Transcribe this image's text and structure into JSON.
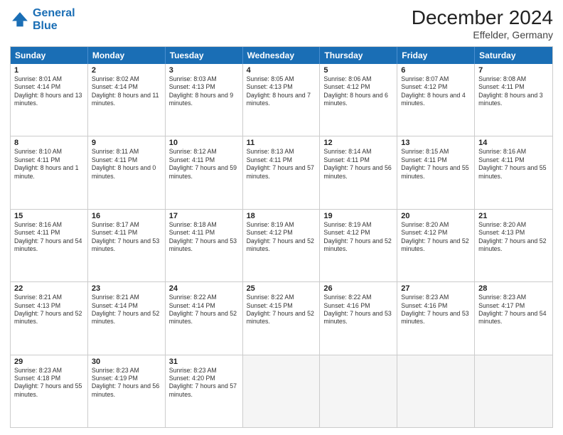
{
  "header": {
    "logo_line1": "General",
    "logo_line2": "Blue",
    "month_title": "December 2024",
    "location": "Effelder, Germany"
  },
  "days_of_week": [
    "Sunday",
    "Monday",
    "Tuesday",
    "Wednesday",
    "Thursday",
    "Friday",
    "Saturday"
  ],
  "weeks": [
    [
      {
        "day": "1",
        "lines": [
          "Sunrise: 8:01 AM",
          "Sunset: 4:14 PM",
          "Daylight: 8 hours",
          "and 13 minutes."
        ]
      },
      {
        "day": "2",
        "lines": [
          "Sunrise: 8:02 AM",
          "Sunset: 4:14 PM",
          "Daylight: 8 hours",
          "and 11 minutes."
        ]
      },
      {
        "day": "3",
        "lines": [
          "Sunrise: 8:03 AM",
          "Sunset: 4:13 PM",
          "Daylight: 8 hours",
          "and 9 minutes."
        ]
      },
      {
        "day": "4",
        "lines": [
          "Sunrise: 8:05 AM",
          "Sunset: 4:13 PM",
          "Daylight: 8 hours",
          "and 7 minutes."
        ]
      },
      {
        "day": "5",
        "lines": [
          "Sunrise: 8:06 AM",
          "Sunset: 4:12 PM",
          "Daylight: 8 hours",
          "and 6 minutes."
        ]
      },
      {
        "day": "6",
        "lines": [
          "Sunrise: 8:07 AM",
          "Sunset: 4:12 PM",
          "Daylight: 8 hours",
          "and 4 minutes."
        ]
      },
      {
        "day": "7",
        "lines": [
          "Sunrise: 8:08 AM",
          "Sunset: 4:11 PM",
          "Daylight: 8 hours",
          "and 3 minutes."
        ]
      }
    ],
    [
      {
        "day": "8",
        "lines": [
          "Sunrise: 8:10 AM",
          "Sunset: 4:11 PM",
          "Daylight: 8 hours",
          "and 1 minute."
        ]
      },
      {
        "day": "9",
        "lines": [
          "Sunrise: 8:11 AM",
          "Sunset: 4:11 PM",
          "Daylight: 8 hours",
          "and 0 minutes."
        ]
      },
      {
        "day": "10",
        "lines": [
          "Sunrise: 8:12 AM",
          "Sunset: 4:11 PM",
          "Daylight: 7 hours",
          "and 59 minutes."
        ]
      },
      {
        "day": "11",
        "lines": [
          "Sunrise: 8:13 AM",
          "Sunset: 4:11 PM",
          "Daylight: 7 hours",
          "and 57 minutes."
        ]
      },
      {
        "day": "12",
        "lines": [
          "Sunrise: 8:14 AM",
          "Sunset: 4:11 PM",
          "Daylight: 7 hours",
          "and 56 minutes."
        ]
      },
      {
        "day": "13",
        "lines": [
          "Sunrise: 8:15 AM",
          "Sunset: 4:11 PM",
          "Daylight: 7 hours",
          "and 55 minutes."
        ]
      },
      {
        "day": "14",
        "lines": [
          "Sunrise: 8:16 AM",
          "Sunset: 4:11 PM",
          "Daylight: 7 hours",
          "and 55 minutes."
        ]
      }
    ],
    [
      {
        "day": "15",
        "lines": [
          "Sunrise: 8:16 AM",
          "Sunset: 4:11 PM",
          "Daylight: 7 hours",
          "and 54 minutes."
        ]
      },
      {
        "day": "16",
        "lines": [
          "Sunrise: 8:17 AM",
          "Sunset: 4:11 PM",
          "Daylight: 7 hours",
          "and 53 minutes."
        ]
      },
      {
        "day": "17",
        "lines": [
          "Sunrise: 8:18 AM",
          "Sunset: 4:11 PM",
          "Daylight: 7 hours",
          "and 53 minutes."
        ]
      },
      {
        "day": "18",
        "lines": [
          "Sunrise: 8:19 AM",
          "Sunset: 4:12 PM",
          "Daylight: 7 hours",
          "and 52 minutes."
        ]
      },
      {
        "day": "19",
        "lines": [
          "Sunrise: 8:19 AM",
          "Sunset: 4:12 PM",
          "Daylight: 7 hours",
          "and 52 minutes."
        ]
      },
      {
        "day": "20",
        "lines": [
          "Sunrise: 8:20 AM",
          "Sunset: 4:12 PM",
          "Daylight: 7 hours",
          "and 52 minutes."
        ]
      },
      {
        "day": "21",
        "lines": [
          "Sunrise: 8:20 AM",
          "Sunset: 4:13 PM",
          "Daylight: 7 hours",
          "and 52 minutes."
        ]
      }
    ],
    [
      {
        "day": "22",
        "lines": [
          "Sunrise: 8:21 AM",
          "Sunset: 4:13 PM",
          "Daylight: 7 hours",
          "and 52 minutes."
        ]
      },
      {
        "day": "23",
        "lines": [
          "Sunrise: 8:21 AM",
          "Sunset: 4:14 PM",
          "Daylight: 7 hours",
          "and 52 minutes."
        ]
      },
      {
        "day": "24",
        "lines": [
          "Sunrise: 8:22 AM",
          "Sunset: 4:14 PM",
          "Daylight: 7 hours",
          "and 52 minutes."
        ]
      },
      {
        "day": "25",
        "lines": [
          "Sunrise: 8:22 AM",
          "Sunset: 4:15 PM",
          "Daylight: 7 hours",
          "and 52 minutes."
        ]
      },
      {
        "day": "26",
        "lines": [
          "Sunrise: 8:22 AM",
          "Sunset: 4:16 PM",
          "Daylight: 7 hours",
          "and 53 minutes."
        ]
      },
      {
        "day": "27",
        "lines": [
          "Sunrise: 8:23 AM",
          "Sunset: 4:16 PM",
          "Daylight: 7 hours",
          "and 53 minutes."
        ]
      },
      {
        "day": "28",
        "lines": [
          "Sunrise: 8:23 AM",
          "Sunset: 4:17 PM",
          "Daylight: 7 hours",
          "and 54 minutes."
        ]
      }
    ],
    [
      {
        "day": "29",
        "lines": [
          "Sunrise: 8:23 AM",
          "Sunset: 4:18 PM",
          "Daylight: 7 hours",
          "and 55 minutes."
        ]
      },
      {
        "day": "30",
        "lines": [
          "Sunrise: 8:23 AM",
          "Sunset: 4:19 PM",
          "Daylight: 7 hours",
          "and 56 minutes."
        ]
      },
      {
        "day": "31",
        "lines": [
          "Sunrise: 8:23 AM",
          "Sunset: 4:20 PM",
          "Daylight: 7 hours",
          "and 57 minutes."
        ]
      },
      {
        "day": "",
        "lines": []
      },
      {
        "day": "",
        "lines": []
      },
      {
        "day": "",
        "lines": []
      },
      {
        "day": "",
        "lines": []
      }
    ]
  ]
}
